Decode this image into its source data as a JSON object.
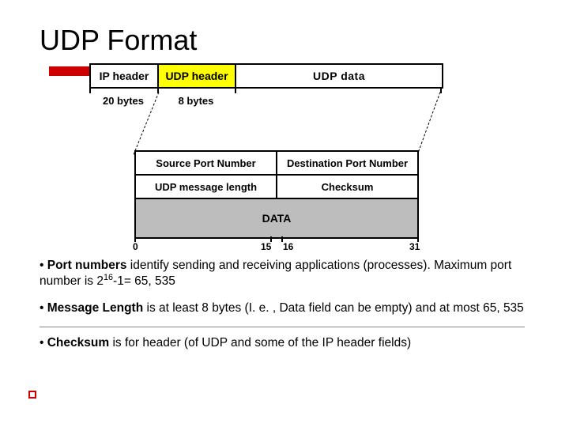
{
  "title": "UDP Format",
  "encap": {
    "ip_header": "IP header",
    "udp_header": "UDP header",
    "udp_data": "UDP data",
    "ip_bytes": "20 bytes",
    "udp_bytes": "8 bytes"
  },
  "dgram": {
    "src_port": "Source Port Number",
    "dst_port": "Destination Port Number",
    "msg_len": "UDP message length",
    "checksum": "Checksum",
    "data": "DATA"
  },
  "ruler": {
    "b0": "0",
    "b15": "15",
    "b16": "16",
    "b31": "31"
  },
  "bullets": {
    "p1a": "Port numbers",
    "p1b": " identify sending and receiving applications (processes). Maximum port number is 2",
    "p1c": "-1= 65, 535",
    "p1exp": "16",
    "p2a": "Message Length",
    "p2b": " is at least 8 bytes (I. e. , Data field can be empty) and at most 65, 535",
    "p3a": "Checksum",
    "p3b": " is for header (of UDP and some of the IP header fields)"
  }
}
